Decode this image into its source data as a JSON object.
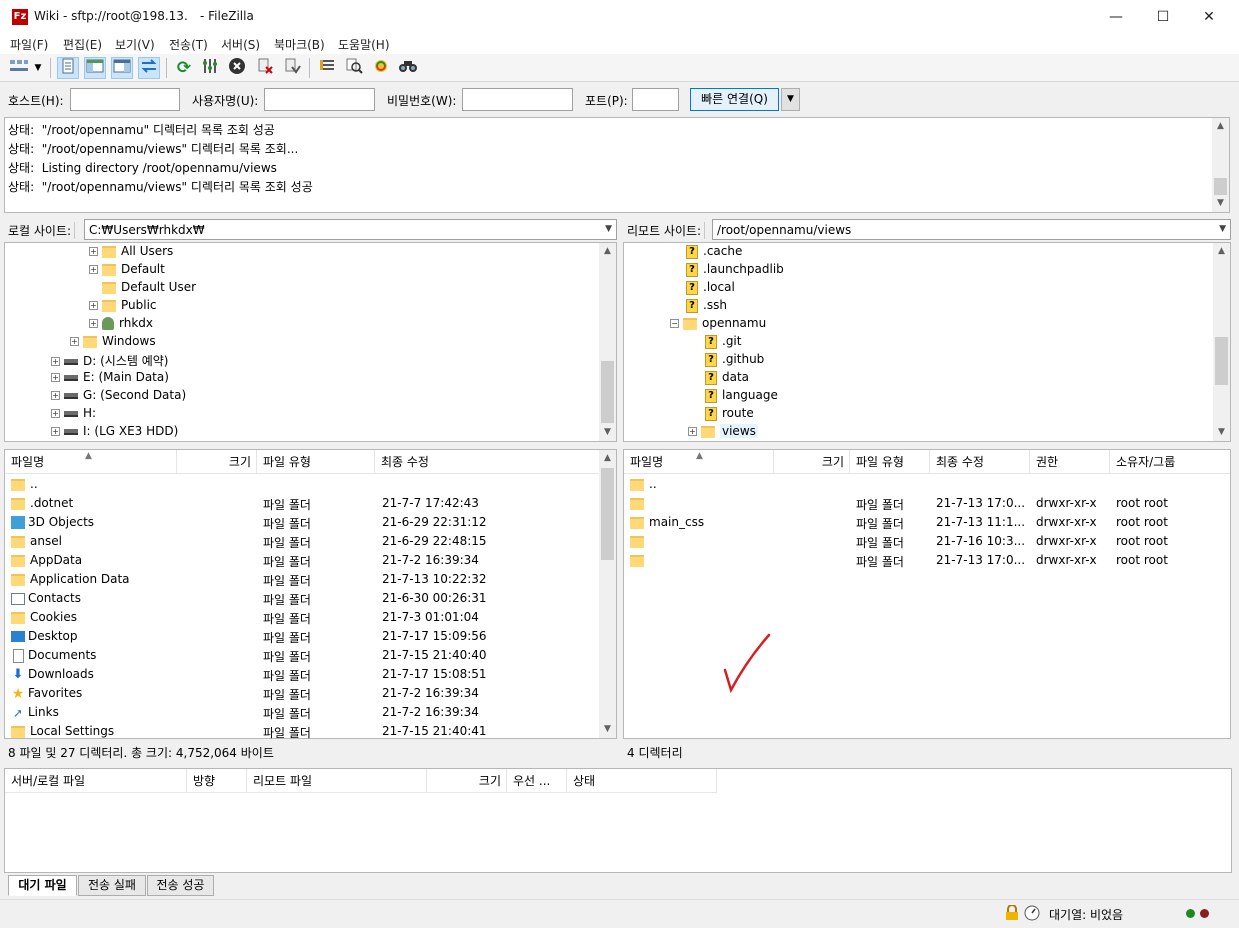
{
  "window": {
    "title_prefix": "Wiki - sftp://root@198.13.",
    "title_suffix": "- FileZilla",
    "minimize": "—",
    "maximize": "☐",
    "close": "✕"
  },
  "menu": [
    "파일(F)",
    "편집(E)",
    "보기(V)",
    "전송(T)",
    "서버(S)",
    "북마크(B)",
    "도움말(H)"
  ],
  "toolbar_icons": [
    "site-manager-icon",
    "dropdown-icon",
    "toggle-log-icon",
    "toggle-local-tree-icon",
    "toggle-remote-tree-icon",
    "toggle-queue-icon",
    "refresh-icon",
    "process-queue-icon",
    "cancel-icon",
    "disconnect-icon",
    "reconnect-icon",
    "filter-icon",
    "compare-icon",
    "sync-browse-icon",
    "search-icon"
  ],
  "quickconnect": {
    "host_label": "호스트(H):",
    "user_label": "사용자명(U):",
    "pass_label": "비밀번호(W):",
    "port_label": "포트(P):",
    "host_value": "",
    "user_value": "",
    "pass_value": "",
    "port_value": "",
    "connect_button": "빠른 연결(Q)"
  },
  "log": [
    {
      "prefix": "상태:",
      "text": "\"/root/opennamu\" 디렉터리 목록 조회 성공"
    },
    {
      "prefix": "상태:",
      "text": "\"/root/opennamu/views\" 디렉터리 목록 조회..."
    },
    {
      "prefix": "상태:",
      "text": "Listing directory /root/opennamu/views"
    },
    {
      "prefix": "상태:",
      "text": "\"/root/opennamu/views\" 디렉터리 목록 조회 성공"
    }
  ],
  "local": {
    "site_label": "로컬 사이트:",
    "path": "C:₩Users₩rhkdx₩",
    "tree": [
      {
        "label": "All Users",
        "icon": "folder",
        "expander": "+"
      },
      {
        "label": "Default",
        "icon": "folder",
        "expander": "+"
      },
      {
        "label": "Default User",
        "icon": "folder",
        "expander": ""
      },
      {
        "label": "Public",
        "icon": "folder",
        "expander": "+"
      },
      {
        "label": "rhkdx",
        "icon": "user",
        "expander": "+"
      },
      {
        "label": "Windows",
        "icon": "folder",
        "expander": "+"
      },
      {
        "label": "D: (시스템 예약)",
        "icon": "drive",
        "expander": "+"
      },
      {
        "label": "E: (Main Data)",
        "icon": "drive",
        "expander": "+"
      },
      {
        "label": "G: (Second Data)",
        "icon": "drive",
        "expander": "+"
      },
      {
        "label": "H:",
        "icon": "drive",
        "expander": "+"
      },
      {
        "label": "I: (LG XE3 HDD)",
        "icon": "drive",
        "expander": "+"
      }
    ],
    "columns": {
      "name": "파일명",
      "size": "크기",
      "type": "파일 유형",
      "modified": "최종 수정"
    },
    "files": [
      {
        "name": "..",
        "icon": "folder",
        "type": "",
        "modified": ""
      },
      {
        "name": ".dotnet",
        "icon": "folder",
        "type": "파일 폴더",
        "modified": "21-7-7 17:42:43"
      },
      {
        "name": "3D Objects",
        "icon": "3d",
        "type": "파일 폴더",
        "modified": "21-6-29 22:31:12"
      },
      {
        "name": "ansel",
        "icon": "folder",
        "type": "파일 폴더",
        "modified": "21-6-29 22:48:15"
      },
      {
        "name": "AppData",
        "icon": "folder",
        "type": "파일 폴더",
        "modified": "21-7-2 16:39:34"
      },
      {
        "name": "Application Data",
        "icon": "folder",
        "type": "파일 폴더",
        "modified": "21-7-13 10:22:32"
      },
      {
        "name": "Contacts",
        "icon": "contacts",
        "type": "파일 폴더",
        "modified": "21-6-30 00:26:31"
      },
      {
        "name": "Cookies",
        "icon": "folder",
        "type": "파일 폴더",
        "modified": "21-7-3 01:01:04"
      },
      {
        "name": "Desktop",
        "icon": "desktop",
        "type": "파일 폴더",
        "modified": "21-7-17 15:09:56"
      },
      {
        "name": "Documents",
        "icon": "doc",
        "type": "파일 폴더",
        "modified": "21-7-15 21:40:40"
      },
      {
        "name": "Downloads",
        "icon": "down",
        "type": "파일 폴더",
        "modified": "21-7-17 15:08:51"
      },
      {
        "name": "Favorites",
        "icon": "star",
        "type": "파일 폴더",
        "modified": "21-7-2 16:39:34"
      },
      {
        "name": "Links",
        "icon": "link",
        "type": "파일 폴더",
        "modified": "21-7-2 16:39:34"
      },
      {
        "name": "Local Settings",
        "icon": "folder",
        "type": "파일 폴더",
        "modified": "21-7-15 21:40:41"
      }
    ],
    "status": "8 파일 및 27 디렉터리. 총 크기: 4,752,064 바이트"
  },
  "remote": {
    "site_label": "리모트 사이트:",
    "path": "/root/opennamu/views",
    "tree": [
      {
        "label": ".cache",
        "icon": "qmark",
        "expander": ""
      },
      {
        "label": ".launchpadlib",
        "icon": "qmark",
        "expander": ""
      },
      {
        "label": ".local",
        "icon": "qmark",
        "expander": ""
      },
      {
        "label": ".ssh",
        "icon": "qmark",
        "expander": ""
      },
      {
        "label": "opennamu",
        "icon": "folder",
        "expander": "−"
      },
      {
        "label": ".git",
        "icon": "qmark",
        "expander": ""
      },
      {
        "label": ".github",
        "icon": "qmark",
        "expander": ""
      },
      {
        "label": "data",
        "icon": "qmark",
        "expander": ""
      },
      {
        "label": "language",
        "icon": "qmark",
        "expander": ""
      },
      {
        "label": "route",
        "icon": "qmark",
        "expander": ""
      },
      {
        "label": "views",
        "icon": "folder",
        "expander": "+"
      }
    ],
    "columns": {
      "name": "파일명",
      "size": "크기",
      "type": "파일 유형",
      "modified": "최종 수정",
      "perm": "권한",
      "owner": "소유자/그룹"
    },
    "files": [
      {
        "name": "..",
        "type": "",
        "modified": "",
        "perm": "",
        "owner": ""
      },
      {
        "name": "",
        "type": "파일 폴더",
        "modified": "21-7-13 17:0...",
        "perm": "drwxr-xr-x",
        "owner": "root root"
      },
      {
        "name": "main_css",
        "type": "파일 폴더",
        "modified": "21-7-13 11:1...",
        "perm": "drwxr-xr-x",
        "owner": "root root"
      },
      {
        "name": "",
        "type": "파일 폴더",
        "modified": "21-7-16 10:3...",
        "perm": "drwxr-xr-x",
        "owner": "root root"
      },
      {
        "name": "",
        "type": "파일 폴더",
        "modified": "21-7-13 17:0...",
        "perm": "drwxr-xr-x",
        "owner": "root root"
      }
    ],
    "status": "4 디렉터리"
  },
  "queue": {
    "columns": [
      "서버/로컬 파일",
      "방향",
      "리모트 파일",
      "크기",
      "우선 ...",
      "상태"
    ],
    "tabs": [
      "대기 파일",
      "전송 실패",
      "전송 성공"
    ]
  },
  "statusbar": {
    "queue_text": "대기열: 비었음"
  },
  "colors": {
    "accent": "#0078d7",
    "checkmark": "#d42020"
  }
}
